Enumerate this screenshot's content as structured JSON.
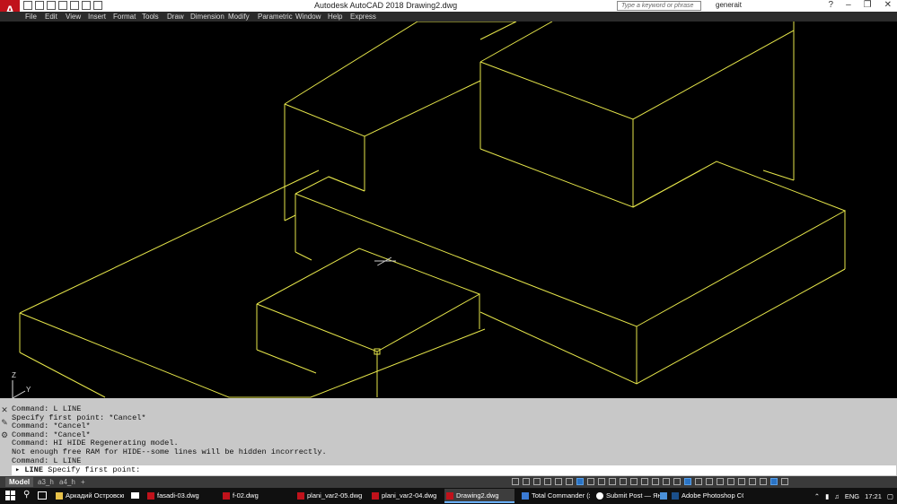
{
  "app": {
    "logo": "A",
    "title": "Autodesk AutoCAD 2018    Drawing2.dwg",
    "search_placeholder": "Type a keyword or phrase",
    "user": "generait",
    "help": "?"
  },
  "menu": [
    "File",
    "Edit",
    "View",
    "Insert",
    "Format",
    "Tools",
    "Draw",
    "Dimension",
    "Modify",
    "Parametric",
    "Window",
    "Help",
    "Express"
  ],
  "ucs": {
    "z": "Z",
    "y": "Y",
    "x": "X"
  },
  "command_history": [
    "Command: L LINE",
    "Specify first point: *Cancel*",
    "Command: *Cancel*",
    "Command: *Cancel*",
    "Command: HI HIDE Regenerating model.",
    "Not enough free RAM for HIDE--some lines will be hidden incorrectly.",
    "Command: L LINE"
  ],
  "command_line": {
    "cmd": "LINE",
    "prompt": "Specify first point:"
  },
  "layout_tabs": [
    "Model",
    "a3_h",
    "a4_h",
    "+"
  ],
  "taskbar": {
    "items": [
      "Аркадий Островски...",
      "fasadi-03.dwg",
      "f-02.dwg",
      "plani_var2-05.dwg",
      "plani_var2-04.dwg",
      "Drawing2.dwg",
      "Total Commander (x6...",
      "Submit Post — Яндек...",
      "",
      "Adobe Photoshop CC..."
    ],
    "lang": "ENG",
    "time": "17:21"
  },
  "colors": {
    "drawing_lines": "#e6e64a",
    "canvas": "#000000",
    "command_panel": "#c8c8c8",
    "title_logo": "#c0121b"
  }
}
